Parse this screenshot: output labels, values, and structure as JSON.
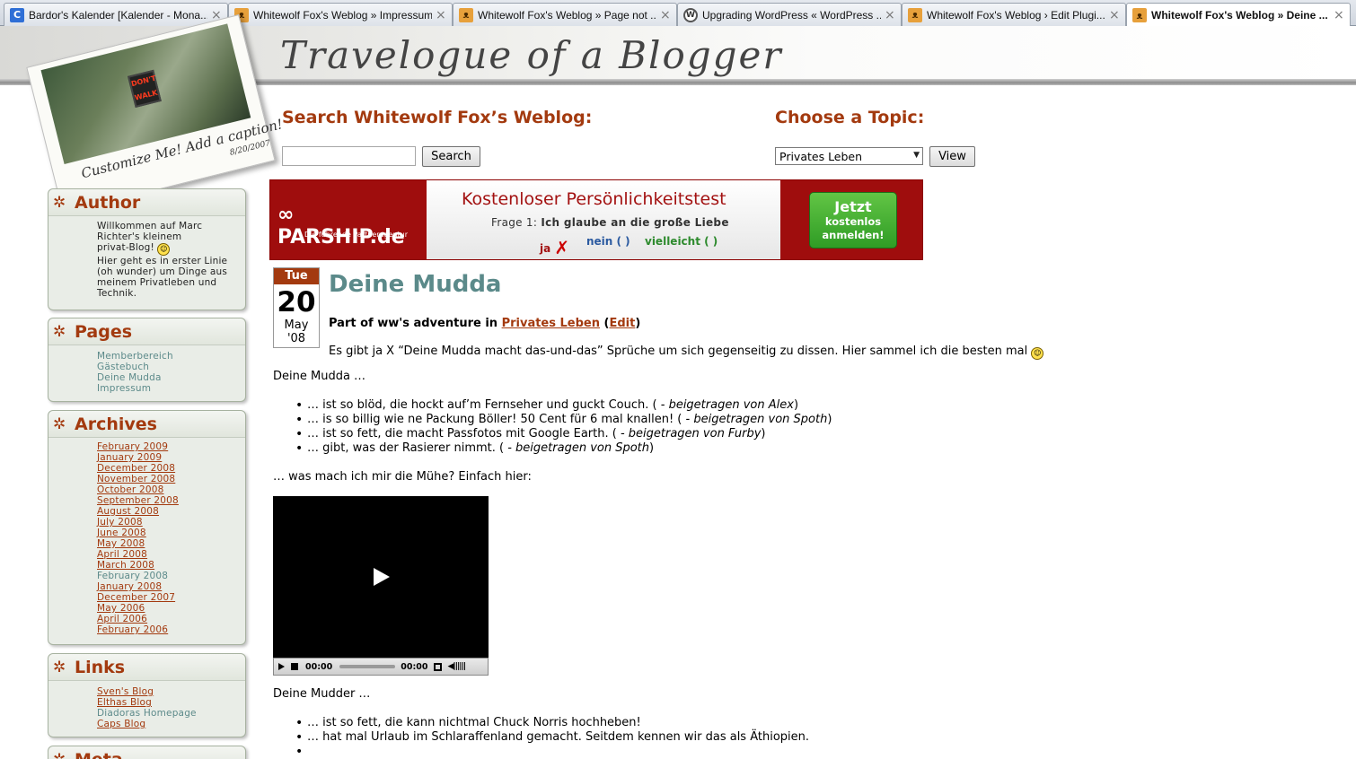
{
  "browser": {
    "tabs": [
      {
        "title": "Bardor's Kalender [Kalender - Mona...",
        "icon": "google-calendar-icon",
        "active": false
      },
      {
        "title": "Whitewolf Fox's Weblog » Impressum",
        "icon": "fox-favicon-icon",
        "active": false
      },
      {
        "title": "Whitewolf Fox's Weblog » Page not ...",
        "icon": "fox-favicon-icon",
        "active": false
      },
      {
        "title": "Upgrading WordPress « WordPress ...",
        "icon": "wordpress-icon",
        "active": false
      },
      {
        "title": "Whitewolf Fox's Weblog › Edit Plugi...",
        "icon": "fox-favicon-icon",
        "active": false
      },
      {
        "title": "Whitewolf Fox's Weblog » Deine ...",
        "icon": "fox-favicon-icon",
        "active": true
      }
    ]
  },
  "header": {
    "blog_title": "Travelogue of a Blogger",
    "polaroid": {
      "sign_top": "DON'T",
      "sign_bottom": "WALK",
      "caption": "Customize Me! Add a caption!",
      "date": "8/20/2007"
    }
  },
  "search": {
    "heading": "Search Whitewolf Fox’s Weblog:",
    "input_value": "",
    "button_label": "Search"
  },
  "topic": {
    "heading": "Choose a Topic:",
    "selected": "Privates Leben",
    "button_label": "View"
  },
  "sidebar": {
    "author": {
      "title": "Author",
      "lines": [
        "Willkommen auf Marc",
        "Richter's kleinem",
        "privat-Blog!",
        "Hier geht es in erster Linie",
        "(oh wunder) um Dinge aus",
        "meinem Privatleben und",
        "Technik."
      ]
    },
    "pages": {
      "title": "Pages",
      "items": [
        "Memberbereich",
        "Gästebuch",
        "Deine Mudda",
        "Impressum"
      ]
    },
    "archives": {
      "title": "Archives",
      "items": [
        {
          "label": "February 2009",
          "visited": false
        },
        {
          "label": "January 2009",
          "visited": false
        },
        {
          "label": "December 2008",
          "visited": false
        },
        {
          "label": "November 2008",
          "visited": false
        },
        {
          "label": "October 2008",
          "visited": false
        },
        {
          "label": "September 2008",
          "visited": false
        },
        {
          "label": "August 2008",
          "visited": false
        },
        {
          "label": "July 2008",
          "visited": false
        },
        {
          "label": "June 2008",
          "visited": false
        },
        {
          "label": "May 2008",
          "visited": false
        },
        {
          "label": "April 2008",
          "visited": false
        },
        {
          "label": "March 2008",
          "visited": false
        },
        {
          "label": "February 2008",
          "visited": true
        },
        {
          "label": "January 2008",
          "visited": false
        },
        {
          "label": "December 2007",
          "visited": false
        },
        {
          "label": "May 2006",
          "visited": false
        },
        {
          "label": "April 2006",
          "visited": false
        },
        {
          "label": "February 2006",
          "visited": false
        }
      ]
    },
    "links": {
      "title": "Links",
      "items": [
        {
          "label": "Sven's Blog",
          "visited": false
        },
        {
          "label": "Elthas Blog",
          "visited": false
        },
        {
          "label": "Diadoras Homepage",
          "visited": true
        },
        {
          "label": "Caps Blog",
          "visited": false
        }
      ]
    },
    "meta": {
      "title": "Meta"
    }
  },
  "ad": {
    "logo": "PARSHIP.de",
    "tagline": "Die führende Partneragentur",
    "headline": "Kostenloser Persönlichkeitstest",
    "question_prefix": "Frage 1:",
    "question": "Ich glaube an die große Liebe",
    "option_yes": "ja",
    "option_no": "nein",
    "option_maybe": "vielleicht",
    "cta_line1": "Jetzt",
    "cta_line2": "kostenlos",
    "cta_line3": "anmelden!"
  },
  "post": {
    "date": {
      "weekday": "Tue",
      "day": "20",
      "month": "May",
      "year": "'08"
    },
    "title": "Deine Mudda",
    "meta_prefix": "Part of ww's adventure in",
    "category": "Privates Leben",
    "edit_label": "Edit",
    "intro": "Es gibt ja X “Deine Mudda macht das-und-das” Sprüche um sich gegenseitig zu dissen. Hier sammel ich die besten mal",
    "section1_heading": "Deine Mudda …",
    "list1": [
      {
        "text": "… ist so blöd, die hockt auf’m Fernseher und guckt Couch. (",
        "credit": "- beigetragen von Alex",
        "end": ")"
      },
      {
        "text": "… is so billig wie ne Packung Böller! 50 Cent für 6 mal knallen! (",
        "credit": "- beigetragen von Spoth",
        "end": ")"
      },
      {
        "text": "… ist so fett, die macht Passfotos mit Google Earth. (",
        "credit": "- beigetragen von Furby",
        "end": ")"
      },
      {
        "text": "… gibt, was der Rasierer nimmt. (",
        "credit": "- beigetragen von Spoth",
        "end": ")"
      }
    ],
    "video_intro": "… was mach ich mir die Mühe? Einfach hier:",
    "video": {
      "time_current": "00:00",
      "time_total": "00:00"
    },
    "section2_heading": "Deine Mudder …",
    "list2": [
      "… ist so fett, die kann nichtmal Chuck Norris hochheben!",
      "… hat mal Urlaub im Schlaraffenland gemacht. Seitdem kennen wir das als Äthiopien.",
      ""
    ]
  }
}
